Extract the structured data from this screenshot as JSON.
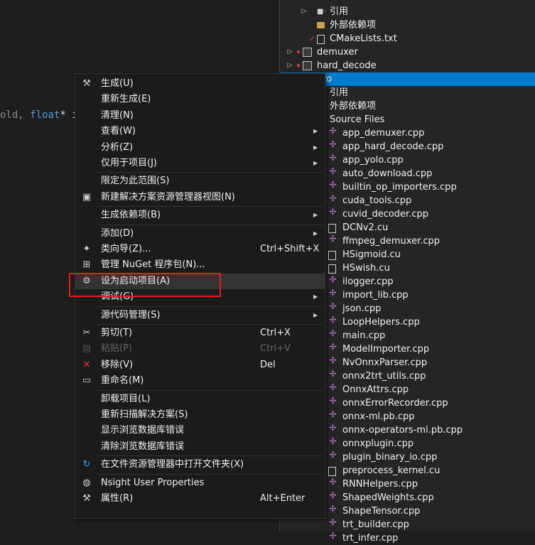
{
  "editor": {
    "code_prefix": "old, ",
    "code_keyword": "float",
    "code_suffix": "* i"
  },
  "explorer": {
    "rows": [
      {
        "label": "引用",
        "icon": "reference-icon",
        "depth": 3
      },
      {
        "label": "外部依赖项",
        "icon": "external-deps-icon",
        "depth": 3
      },
      {
        "label": "CMakeLists.txt",
        "icon": "text-file-icon",
        "depth": 3
      },
      {
        "label": "demuxer",
        "icon": "project-icon",
        "depth": 1
      },
      {
        "label": "hard_decode",
        "icon": "project-icon",
        "depth": 1
      },
      {
        "label": "pro",
        "icon": "project-icon",
        "depth": 1,
        "selected": true
      },
      {
        "label": "引用",
        "icon": "reference-icon",
        "depth": 2
      },
      {
        "label": "外部依赖项",
        "icon": "external-deps-icon",
        "depth": 2
      },
      {
        "label": "Source Files",
        "icon": "folder-icon",
        "depth": 2
      },
      {
        "label": "app_demuxer.cpp",
        "icon": "cpp-file-icon",
        "depth": 3
      },
      {
        "label": "app_hard_decode.cpp",
        "icon": "cpp-file-icon",
        "depth": 3
      },
      {
        "label": "app_yolo.cpp",
        "icon": "cpp-file-icon",
        "depth": 3
      },
      {
        "label": "auto_download.cpp",
        "icon": "cpp-file-icon",
        "depth": 3
      },
      {
        "label": "builtin_op_importers.cpp",
        "icon": "cpp-file-icon",
        "depth": 3
      },
      {
        "label": "cuda_tools.cpp",
        "icon": "cpp-file-icon",
        "depth": 3
      },
      {
        "label": "cuvid_decoder.cpp",
        "icon": "cpp-file-icon",
        "depth": 3
      },
      {
        "label": "DCNv2.cu",
        "icon": "file-icon",
        "depth": 3
      },
      {
        "label": "ffmpeg_demuxer.cpp",
        "icon": "cpp-file-icon",
        "depth": 3
      },
      {
        "label": "HSigmoid.cu",
        "icon": "file-icon",
        "depth": 3
      },
      {
        "label": "HSwish.cu",
        "icon": "file-icon",
        "depth": 3
      },
      {
        "label": "ilogger.cpp",
        "icon": "cpp-file-icon",
        "depth": 3
      },
      {
        "label": "import_lib.cpp",
        "icon": "cpp-file-icon",
        "depth": 3
      },
      {
        "label": "json.cpp",
        "icon": "cpp-file-icon",
        "depth": 3
      },
      {
        "label": "LoopHelpers.cpp",
        "icon": "cpp-file-icon",
        "depth": 3
      },
      {
        "label": "main.cpp",
        "icon": "cpp-file-icon",
        "depth": 3
      },
      {
        "label": "ModelImporter.cpp",
        "icon": "cpp-file-icon",
        "depth": 3
      },
      {
        "label": "NvOnnxParser.cpp",
        "icon": "cpp-file-icon",
        "depth": 3
      },
      {
        "label": "onnx2trt_utils.cpp",
        "icon": "cpp-file-icon",
        "depth": 3
      },
      {
        "label": "OnnxAttrs.cpp",
        "icon": "cpp-file-icon",
        "depth": 3
      },
      {
        "label": "onnxErrorRecorder.cpp",
        "icon": "cpp-file-icon",
        "depth": 3
      },
      {
        "label": "onnx-ml.pb.cpp",
        "icon": "cpp-file-icon",
        "depth": 3
      },
      {
        "label": "onnx-operators-ml.pb.cpp",
        "icon": "cpp-file-icon",
        "depth": 3
      },
      {
        "label": "onnxplugin.cpp",
        "icon": "cpp-file-icon",
        "depth": 3
      },
      {
        "label": "plugin_binary_io.cpp",
        "icon": "cpp-file-icon",
        "depth": 3
      },
      {
        "label": "preprocess_kernel.cu",
        "icon": "file-icon",
        "depth": 3
      },
      {
        "label": "RNNHelpers.cpp",
        "icon": "cpp-file-icon",
        "depth": 3
      },
      {
        "label": "ShapedWeights.cpp",
        "icon": "cpp-file-icon",
        "depth": 3
      },
      {
        "label": "ShapeTensor.cpp",
        "icon": "cpp-file-icon",
        "depth": 3
      },
      {
        "label": "trt_builder.cpp",
        "icon": "cpp-file-icon",
        "depth": 3
      },
      {
        "label": "trt_infer.cpp",
        "icon": "cpp-file-icon",
        "depth": 3
      }
    ]
  },
  "menu": {
    "items": [
      {
        "label": "生成(U)",
        "icon": "build-icon"
      },
      {
        "label": "重新生成(E)"
      },
      {
        "label": "清理(N)"
      },
      {
        "label": "查看(W)",
        "submenu": true
      },
      {
        "label": "分析(Z)",
        "submenu": true
      },
      {
        "label": "仅用于项目(J)",
        "submenu": true
      },
      {
        "sep": true
      },
      {
        "label": "限定为此范围(S)"
      },
      {
        "label": "新建解决方案资源管理器视图(N)",
        "icon": "new-view-icon"
      },
      {
        "sep": true
      },
      {
        "label": "生成依赖项(B)",
        "submenu": true
      },
      {
        "sep": true
      },
      {
        "label": "添加(D)",
        "submenu": true
      },
      {
        "label": "类向导(Z)...",
        "icon": "class-wizard-icon",
        "shortcut": "Ctrl+Shift+X"
      },
      {
        "label": "管理 NuGet 程序包(N)...",
        "icon": "nuget-icon"
      },
      {
        "label": "设为启动项目(A)",
        "icon": "gear-icon",
        "hover": true
      },
      {
        "label": "调试(G)",
        "submenu": true
      },
      {
        "sep": true
      },
      {
        "label": "源代码管理(S)",
        "submenu": true
      },
      {
        "sep": true
      },
      {
        "label": "剪切(T)",
        "icon": "scissors-icon",
        "shortcut": "Ctrl+X"
      },
      {
        "label": "粘贴(P)",
        "icon": "paste-icon",
        "shortcut": "Ctrl+V",
        "disabled": true
      },
      {
        "label": "移除(V)",
        "icon": "remove-icon",
        "shortcut": "Del"
      },
      {
        "label": "重命名(M)",
        "icon": "rename-icon"
      },
      {
        "sep": true
      },
      {
        "label": "卸载项目(L)"
      },
      {
        "label": "重新扫描解决方案(S)"
      },
      {
        "label": "显示浏览数据库错误"
      },
      {
        "label": "清除浏览数据库错误"
      },
      {
        "sep": true
      },
      {
        "label": "在文件资源管理器中打开文件夹(X)",
        "icon": "open-folder-icon"
      },
      {
        "sep": true
      },
      {
        "label": "Nsight User Properties",
        "icon": "nsight-icon"
      },
      {
        "label": "属性(R)",
        "icon": "wrench-icon",
        "shortcut": "Alt+Enter"
      }
    ]
  },
  "colors": {
    "accent": "#007acc",
    "highlight_border": "#e02020",
    "cpp_icon": "#c77dd8"
  }
}
